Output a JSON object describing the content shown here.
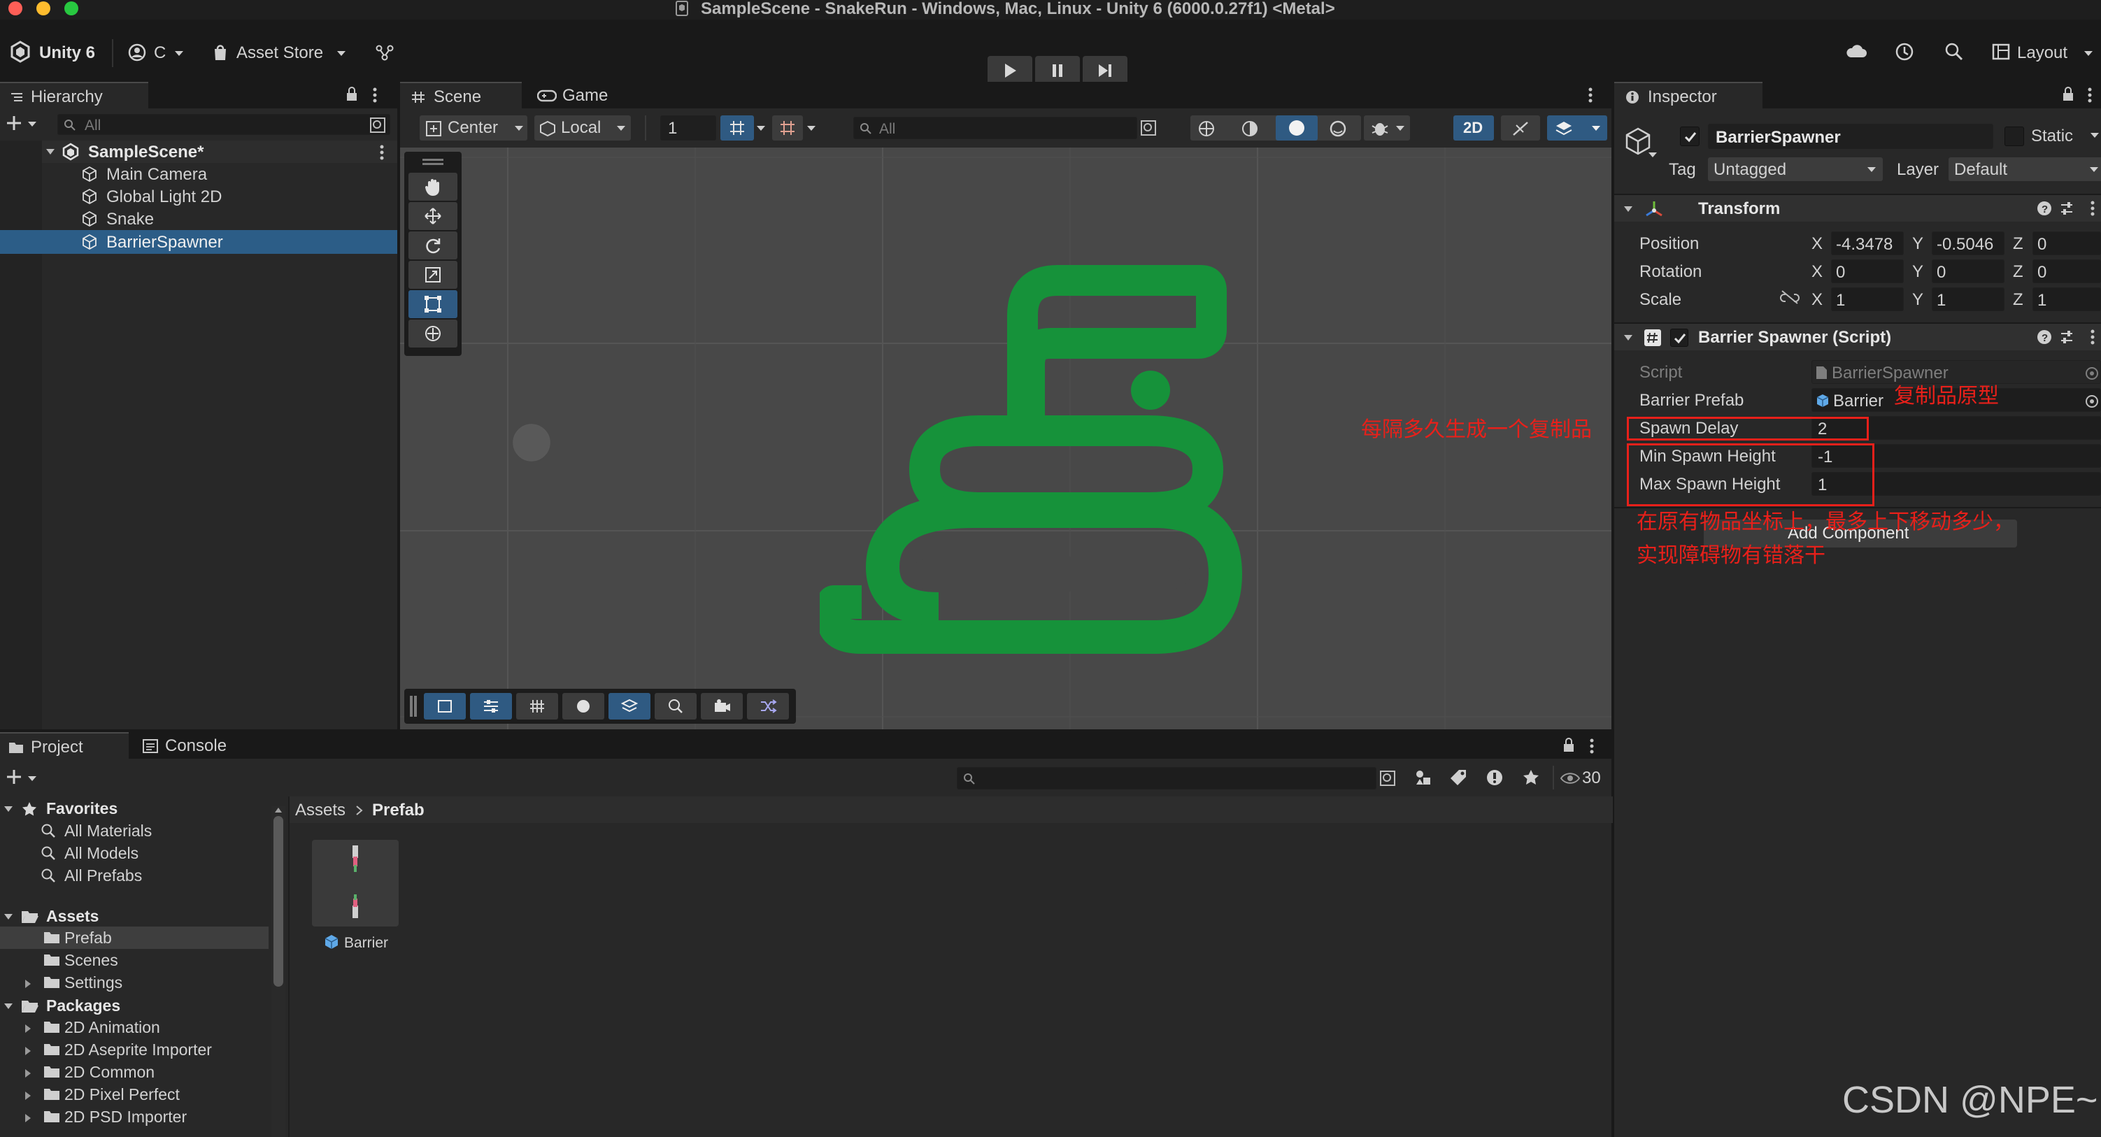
{
  "window": {
    "title": "SampleScene - SnakeRun - Windows, Mac, Linux - Unity 6 (6000.0.27f1) <Metal>"
  },
  "toolbar": {
    "unity_label": "Unity 6",
    "account_label": "C",
    "asset_store_label": "Asset Store",
    "layout_label": "Layout"
  },
  "hierarchy": {
    "tab_label": "Hierarchy",
    "search_placeholder": "All",
    "scene_name": "SampleScene*",
    "items": [
      {
        "label": "Main Camera",
        "selected": false
      },
      {
        "label": "Global Light 2D",
        "selected": false
      },
      {
        "label": "Snake",
        "selected": false
      },
      {
        "label": "BarrierSpawner",
        "selected": true
      }
    ]
  },
  "scene": {
    "tabs": [
      {
        "label": "Scene"
      },
      {
        "label": "Game"
      }
    ],
    "pivot_label": "Center",
    "space_label": "Local",
    "grid_value": "1",
    "search_placeholder": "All",
    "mode_2d_label": "2D",
    "logo_color": "#16923a",
    "tools": [
      "hand-icon",
      "move-icon",
      "rotate-icon",
      "scale-icon",
      "rect-icon",
      "transform-icon"
    ]
  },
  "inspector": {
    "tab_label": "Inspector",
    "object_name": "BarrierSpawner",
    "static_label": "Static",
    "tag_label": "Tag",
    "tag_value": "Untagged",
    "layer_label": "Layer",
    "layer_value": "Default",
    "transform": {
      "title": "Transform",
      "rows": [
        {
          "label": "Position",
          "x": "-4.3478",
          "y": "-0.5046",
          "z": "0"
        },
        {
          "label": "Rotation",
          "x": "0",
          "y": "0",
          "z": "0"
        },
        {
          "label": "Scale",
          "x": "1",
          "y": "1",
          "z": "1"
        }
      ],
      "axis_x": "X",
      "axis_y": "Y",
      "axis_z": "Z"
    },
    "script_component": {
      "title": "Barrier Spawner (Script)",
      "script_label": "Script",
      "script_value": "BarrierSpawner",
      "prefab_label": "Barrier Prefab",
      "prefab_value": "Barrier",
      "spawn_delay_label": "Spawn Delay",
      "spawn_delay_value": "2",
      "min_height_label": "Min Spawn Height",
      "min_height_value": "-1",
      "max_height_label": "Max Spawn Height",
      "max_height_value": "1"
    },
    "add_component_label": "Add Component"
  },
  "annotations": {
    "prefab_note": "复制品原型",
    "delay_note": "每隔多久生成一个复制品",
    "height_note_line1": "在原有物品坐标上，最多上下移动多少，",
    "height_note_line2": "实现障碍物有错落干",
    "color": "#e8201a"
  },
  "project": {
    "tabs": [
      {
        "label": "Project"
      },
      {
        "label": "Console"
      }
    ],
    "hidden_count": "30",
    "breadcrumb": [
      "Assets",
      "Prefab"
    ],
    "favorites_label": "Favorites",
    "favorites": [
      "All Materials",
      "All Models",
      "All Prefabs"
    ],
    "assets_label": "Assets",
    "assets": [
      {
        "label": "Prefab",
        "selected": true
      },
      {
        "label": "Scenes",
        "selected": false
      },
      {
        "label": "Settings",
        "selected": false
      }
    ],
    "packages_label": "Packages",
    "packages": [
      "2D Animation",
      "2D Aseprite Importer",
      "2D Common",
      "2D Pixel Perfect",
      "2D PSD Importer"
    ],
    "asset_items": [
      {
        "label": "Barrier"
      }
    ]
  },
  "watermark": "CSDN @NPE~"
}
